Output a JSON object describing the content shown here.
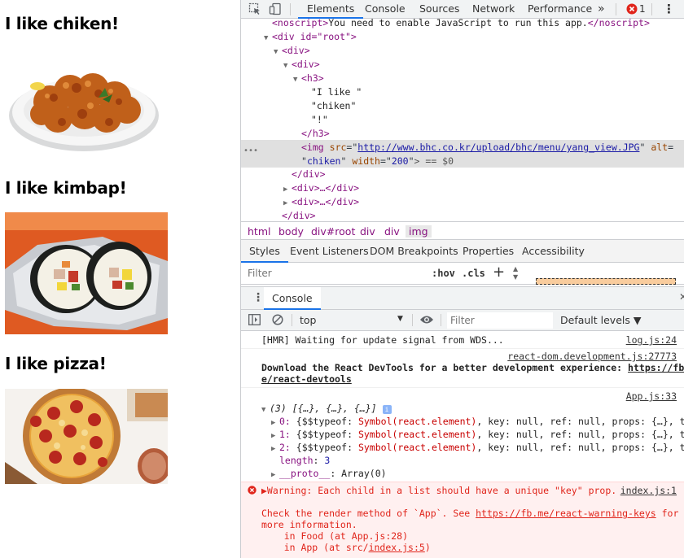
{
  "app": {
    "foods": [
      {
        "title": "I like chiken!",
        "image": "fried chicken on a plate"
      },
      {
        "title": "I like kimbap!",
        "image": "kimbap rolls in foil"
      },
      {
        "title": "I like pizza!",
        "image": "pepperoni pizza"
      }
    ]
  },
  "devtools": {
    "tabs": [
      "Elements",
      "Console",
      "Sources",
      "Network",
      "Performance"
    ],
    "more": "»",
    "error_count": "1",
    "menu_icon": "⋮",
    "close_icon": "✕",
    "elements_tree": {
      "noscript_open": "<noscript>",
      "noscript_text": "You need to enable JavaScript to run this app.",
      "noscript_close": "</noscript>",
      "root_div": "<div id=\"root\">",
      "div1": "<div>",
      "div2": "<div>",
      "h3_open": "<h3>",
      "text1": "\"I like \"",
      "text2": "\"chiken\"",
      "text3": "\"!\"",
      "h3_close": "</h3>",
      "img_tag": "<img",
      "img_src_attr": "src",
      "img_src_val": "http://www.bhc.co.kr/upload/bhc/menu/yang_view.JPG",
      "img_alt_attr": "alt",
      "img_alt_val": "chiken",
      "img_width_attr": "width",
      "img_width_val": "200",
      "img_tail": "> == $0",
      "div_close": "</div>",
      "collapsed1": "<div>…</div>",
      "collapsed2": "<div>…</div>",
      "div_close2": "</div>",
      "dots": "•••"
    },
    "breadcrumbs": [
      "html",
      "body",
      "div#root",
      "div",
      "div",
      "img"
    ],
    "subtabs": [
      "Styles",
      "Event Listeners",
      "DOM Breakpoints",
      "Properties",
      "Accessibility"
    ],
    "styles_filter": {
      "placeholder": "Filter",
      "hov": ":hov",
      "cls": ".cls",
      "plus": "+"
    },
    "console": {
      "tab_label": "Console",
      "context": "top",
      "filter_placeholder": "Filter",
      "levels": "Default levels ▼",
      "messages": {
        "hmr": "[HMR] Waiting for update signal from WDS...",
        "hmr_src": "log.js:24",
        "react_src": "react-dom.development.js:27773",
        "react_line1": "Download the React DevTools for a better development experience: ",
        "react_link1": "https://fb.m",
        "react_link2": "e/react-devtools",
        "app_src": "App.js:33",
        "array_head": "(3) [{…}, {…}, {…}]",
        "array_items": [
          {
            "idx": "0:",
            "rest": " {$$typeof: ",
            "sym": "Symbol(react.element)",
            "tail": ", key: null, ref: null, props: {…}, ty…"
          },
          {
            "idx": "1:",
            "rest": " {$$typeof: ",
            "sym": "Symbol(react.element)",
            "tail": ", key: null, ref: null, props: {…}, ty…"
          },
          {
            "idx": "2:",
            "rest": " {$$typeof: ",
            "sym": "Symbol(react.element)",
            "tail": ", key: null, ref: null, props: {…}, ty…"
          }
        ],
        "length_key": "length",
        "length_val": "3",
        "proto_key": "__proto__",
        "proto_val": ": Array(0)",
        "warn_line": "▶Warning: Each child in a list should have a unique \"key\" prop.",
        "warn_src": "index.js:1",
        "warn_check": "Check the render method of `App`. See ",
        "warn_link": "https://fb.me/react-warning-keys",
        "warn_for": " for",
        "warn_more": "more information.",
        "warn_food_pre": "    in Food (at App.js:28)",
        "warn_app_pre": "    in App (at src/",
        "warn_app_link": "index.js:5",
        "warn_app_end": ")"
      }
    }
  }
}
